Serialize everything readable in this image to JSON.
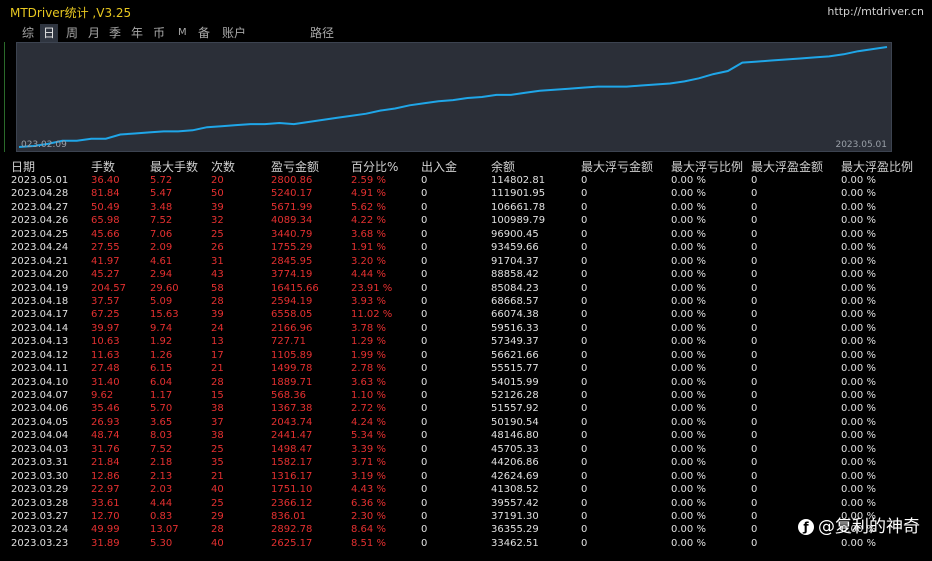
{
  "window": {
    "title": "MTDriver统计 ,V3.25",
    "url": "http://mtdriver.cn"
  },
  "tabs": [
    {
      "label": "综",
      "active": false
    },
    {
      "label": "日",
      "active": true
    },
    {
      "label": "周",
      "active": false
    },
    {
      "label": "月",
      "active": false
    },
    {
      "label": "季",
      "active": false
    },
    {
      "label": "年",
      "active": false
    },
    {
      "label": "币",
      "active": false
    },
    {
      "label": "M",
      "active": false
    },
    {
      "label": "备",
      "active": false
    },
    {
      "label": "账户",
      "active": false
    },
    {
      "label": "路径",
      "active": false
    }
  ],
  "chart": {
    "start_label": "023.02.09",
    "end_label": "2023.05.01",
    "line_color": "#1fa6e8"
  },
  "chart_data": {
    "type": "line",
    "x_start": "2023.02.09",
    "x_end": "2023.05.01",
    "series": [
      {
        "values": [
          0,
          1,
          3,
          6,
          6,
          8,
          8,
          12,
          13,
          14,
          15,
          15,
          16,
          19,
          20,
          21,
          22,
          22,
          23,
          22,
          24,
          26,
          28,
          30,
          32,
          35,
          37,
          40,
          42,
          44,
          45,
          47,
          48,
          50,
          50,
          52,
          54,
          55,
          56,
          57,
          58,
          58,
          58,
          59,
          60,
          61,
          63,
          66,
          70,
          73,
          81,
          82,
          83,
          84,
          85,
          86,
          87,
          89,
          92,
          94,
          96
        ]
      }
    ]
  },
  "table": {
    "headers": [
      "日期",
      "手数",
      "最大手数",
      "次数",
      "盈亏金额",
      "百分比%",
      "出入金",
      "余额",
      "最大浮亏金额",
      "最大浮亏比例",
      "最大浮盈金额",
      "最大浮盈比例"
    ],
    "rows": [
      [
        "2023.05.01",
        "36.40",
        "5.72",
        "20",
        "2800.86",
        "2.59 %",
        "0",
        "114802.81",
        "0",
        "0.00 %",
        "0",
        "0.00 %"
      ],
      [
        "2023.04.28",
        "81.84",
        "5.47",
        "50",
        "5240.17",
        "4.91 %",
        "0",
        "111901.95",
        "0",
        "0.00 %",
        "0",
        "0.00 %"
      ],
      [
        "2023.04.27",
        "50.49",
        "3.48",
        "39",
        "5671.99",
        "5.62 %",
        "0",
        "106661.78",
        "0",
        "0.00 %",
        "0",
        "0.00 %"
      ],
      [
        "2023.04.26",
        "65.98",
        "7.52",
        "32",
        "4089.34",
        "4.22 %",
        "0",
        "100989.79",
        "0",
        "0.00 %",
        "0",
        "0.00 %"
      ],
      [
        "2023.04.25",
        "45.66",
        "7.06",
        "25",
        "3440.79",
        "3.68 %",
        "0",
        "96900.45",
        "0",
        "0.00 %",
        "0",
        "0.00 %"
      ],
      [
        "2023.04.24",
        "27.55",
        "2.09",
        "26",
        "1755.29",
        "1.91 %",
        "0",
        "93459.66",
        "0",
        "0.00 %",
        "0",
        "0.00 %"
      ],
      [
        "2023.04.21",
        "41.97",
        "4.61",
        "31",
        "2845.95",
        "3.20 %",
        "0",
        "91704.37",
        "0",
        "0.00 %",
        "0",
        "0.00 %"
      ],
      [
        "2023.04.20",
        "45.27",
        "2.94",
        "43",
        "3774.19",
        "4.44 %",
        "0",
        "88858.42",
        "0",
        "0.00 %",
        "0",
        "0.00 %"
      ],
      [
        "2023.04.19",
        "204.57",
        "29.60",
        "58",
        "16415.66",
        "23.91 %",
        "0",
        "85084.23",
        "0",
        "0.00 %",
        "0",
        "0.00 %"
      ],
      [
        "2023.04.18",
        "37.57",
        "5.09",
        "28",
        "2594.19",
        "3.93 %",
        "0",
        "68668.57",
        "0",
        "0.00 %",
        "0",
        "0.00 %"
      ],
      [
        "2023.04.17",
        "67.25",
        "15.63",
        "39",
        "6558.05",
        "11.02 %",
        "0",
        "66074.38",
        "0",
        "0.00 %",
        "0",
        "0.00 %"
      ],
      [
        "2023.04.14",
        "39.97",
        "9.74",
        "24",
        "2166.96",
        "3.78 %",
        "0",
        "59516.33",
        "0",
        "0.00 %",
        "0",
        "0.00 %"
      ],
      [
        "2023.04.13",
        "10.63",
        "1.92",
        "13",
        "727.71",
        "1.29 %",
        "0",
        "57349.37",
        "0",
        "0.00 %",
        "0",
        "0.00 %"
      ],
      [
        "2023.04.12",
        "11.63",
        "1.26",
        "17",
        "1105.89",
        "1.99 %",
        "0",
        "56621.66",
        "0",
        "0.00 %",
        "0",
        "0.00 %"
      ],
      [
        "2023.04.11",
        "27.48",
        "6.15",
        "21",
        "1499.78",
        "2.78 %",
        "0",
        "55515.77",
        "0",
        "0.00 %",
        "0",
        "0.00 %"
      ],
      [
        "2023.04.10",
        "31.40",
        "6.04",
        "28",
        "1889.71",
        "3.63 %",
        "0",
        "54015.99",
        "0",
        "0.00 %",
        "0",
        "0.00 %"
      ],
      [
        "2023.04.07",
        "9.62",
        "1.17",
        "15",
        "568.36",
        "1.10 %",
        "0",
        "52126.28",
        "0",
        "0.00 %",
        "0",
        "0.00 %"
      ],
      [
        "2023.04.06",
        "35.46",
        "5.70",
        "38",
        "1367.38",
        "2.72 %",
        "0",
        "51557.92",
        "0",
        "0.00 %",
        "0",
        "0.00 %"
      ],
      [
        "2023.04.05",
        "26.93",
        "3.65",
        "37",
        "2043.74",
        "4.24 %",
        "0",
        "50190.54",
        "0",
        "0.00 %",
        "0",
        "0.00 %"
      ],
      [
        "2023.04.04",
        "48.74",
        "8.03",
        "38",
        "2441.47",
        "5.34 %",
        "0",
        "48146.80",
        "0",
        "0.00 %",
        "0",
        "0.00 %"
      ],
      [
        "2023.04.03",
        "31.76",
        "7.52",
        "25",
        "1498.47",
        "3.39 %",
        "0",
        "45705.33",
        "0",
        "0.00 %",
        "0",
        "0.00 %"
      ],
      [
        "2023.03.31",
        "21.84",
        "2.18",
        "35",
        "1582.17",
        "3.71 %",
        "0",
        "44206.86",
        "0",
        "0.00 %",
        "0",
        "0.00 %"
      ],
      [
        "2023.03.30",
        "12.86",
        "2.13",
        "21",
        "1316.17",
        "3.19 %",
        "0",
        "42624.69",
        "0",
        "0.00 %",
        "0",
        "0.00 %"
      ],
      [
        "2023.03.29",
        "22.97",
        "2.03",
        "40",
        "1751.10",
        "4.43 %",
        "0",
        "41308.52",
        "0",
        "0.00 %",
        "0",
        "0.00 %"
      ],
      [
        "2023.03.28",
        "33.61",
        "4.44",
        "25",
        "2366.12",
        "6.36 %",
        "0",
        "39557.42",
        "0",
        "0.00 %",
        "0",
        "0.00 %"
      ],
      [
        "2023.03.27",
        "12.70",
        "0.83",
        "29",
        "836.01",
        "2.30 %",
        "0",
        "37191.30",
        "0",
        "0.00 %",
        "0",
        "0.00 %"
      ],
      [
        "2023.03.24",
        "49.99",
        "13.07",
        "28",
        "2892.78",
        "8.64 %",
        "0",
        "36355.29",
        "0",
        "0.00 %",
        "0",
        "0.00 %"
      ],
      [
        "2023.03.23",
        "31.89",
        "5.30",
        "40",
        "2625.17",
        "8.51 %",
        "0",
        "33462.51",
        "0",
        "0.00 %",
        "0",
        "0.00 %"
      ]
    ]
  },
  "watermark": {
    "icon": "weibo-icon",
    "text": "@复利的神奇"
  },
  "colors": {
    "background": "#000000",
    "chart_bg": "#2b2f38",
    "line": "#1fa6e8",
    "negative_red": "#e53030",
    "title_yellow": "#e8c820"
  }
}
